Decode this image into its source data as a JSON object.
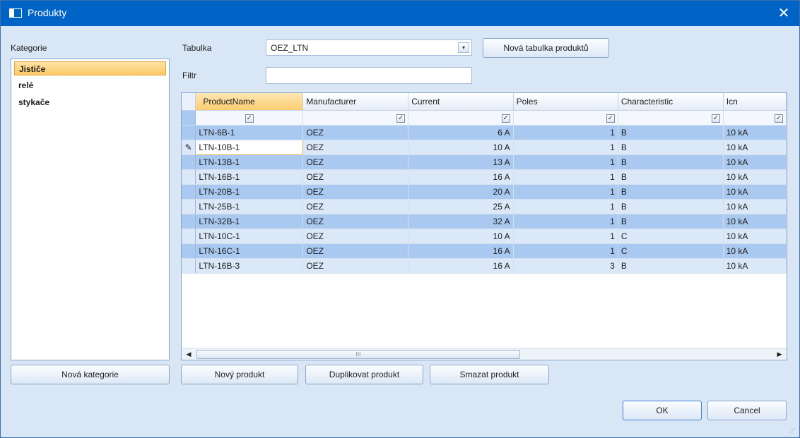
{
  "window": {
    "title": "Produkty"
  },
  "categories": {
    "label": "Kategorie",
    "items": [
      "Jističe",
      "relé",
      "stykače"
    ],
    "selected_index": 0,
    "new_button": "Nová kategorie"
  },
  "table_select": {
    "label": "Tabulka",
    "value": "OEZ_LTN",
    "new_button": "Nová tabulka produktů"
  },
  "filter": {
    "label": "Filtr",
    "value": ""
  },
  "grid": {
    "columns": [
      "ProductName",
      "Manufacturer",
      "Current",
      "Poles",
      "Characteristic",
      "Icn"
    ],
    "rows": [
      [
        "LTN-6B-1",
        "OEZ",
        "6 A",
        "1",
        "B",
        "10 kA"
      ],
      [
        "LTN-10B-1",
        "OEZ",
        "10 A",
        "1",
        "B",
        "10 kA"
      ],
      [
        "LTN-13B-1",
        "OEZ",
        "13 A",
        "1",
        "B",
        "10 kA"
      ],
      [
        "LTN-16B-1",
        "OEZ",
        "16 A",
        "1",
        "B",
        "10 kA"
      ],
      [
        "LTN-20B-1",
        "OEZ",
        "20 A",
        "1",
        "B",
        "10 kA"
      ],
      [
        "LTN-25B-1",
        "OEZ",
        "25 A",
        "1",
        "B",
        "10 kA"
      ],
      [
        "LTN-32B-1",
        "OEZ",
        "32 A",
        "1",
        "B",
        "10 kA"
      ],
      [
        "LTN-10C-1",
        "OEZ",
        "10 A",
        "1",
        "C",
        "10 kA"
      ],
      [
        "LTN-16C-1",
        "OEZ",
        "16 A",
        "1",
        "C",
        "10 kA"
      ],
      [
        "LTN-16B-3",
        "OEZ",
        "16 A",
        "3",
        "B",
        "10 kA"
      ]
    ],
    "editing_row": 1,
    "scroll_thumb_label": "III"
  },
  "product_buttons": {
    "new": "Nový produkt",
    "duplicate": "Duplikovat produkt",
    "delete": "Smazat produkt"
  },
  "dialog_buttons": {
    "ok": "OK",
    "cancel": "Cancel"
  }
}
